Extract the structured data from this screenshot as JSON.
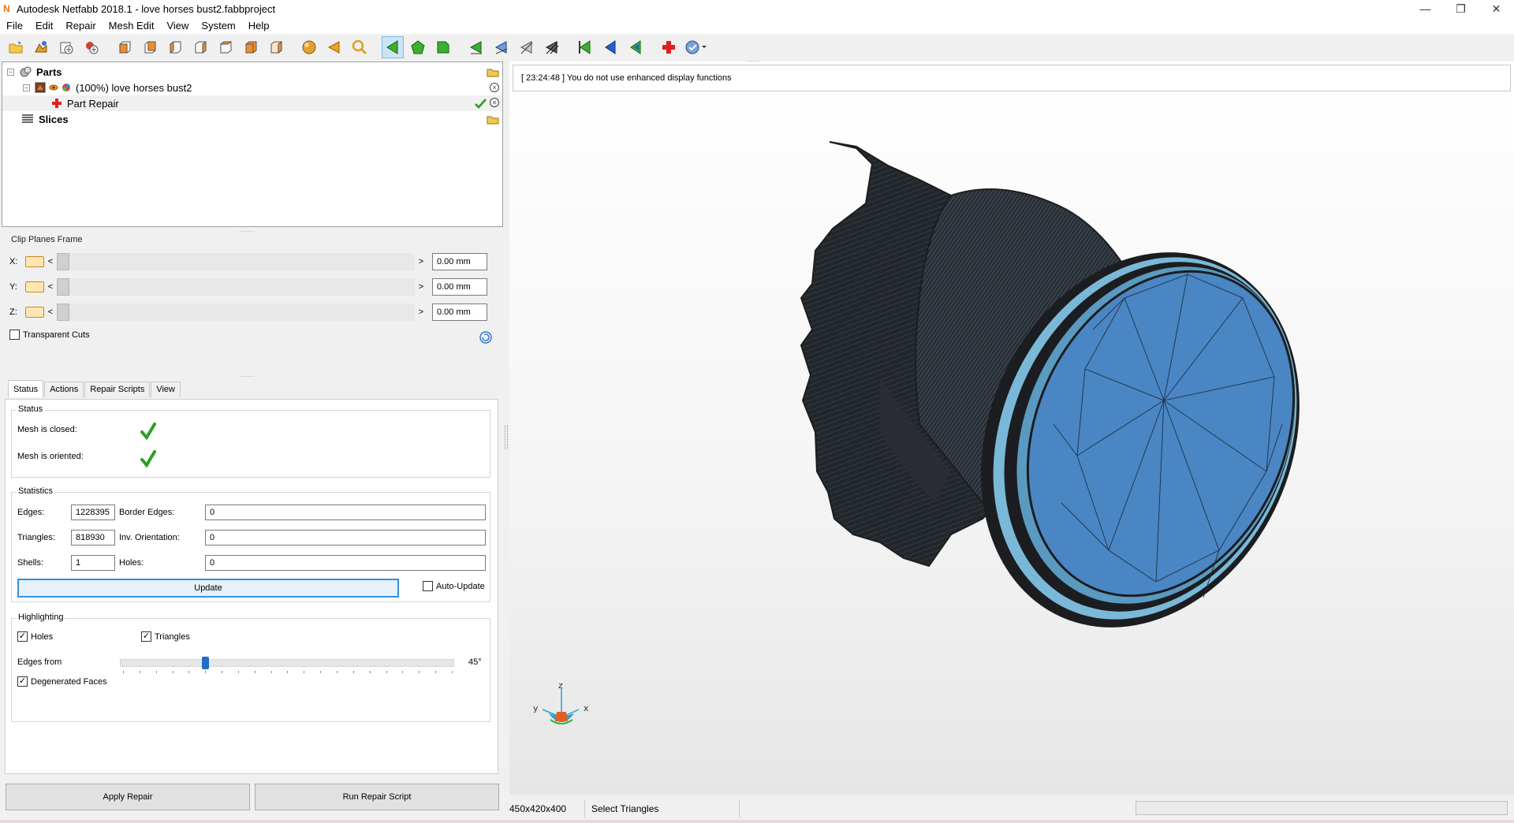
{
  "window": {
    "title": "Autodesk Netfabb 2018.1 - love horses bust2.fabbproject",
    "logo": "N",
    "minimize": "—",
    "maximize": "❐",
    "close": "✕"
  },
  "menu": [
    "File",
    "Edit",
    "Repair",
    "Mesh Edit",
    "View",
    "System",
    "Help"
  ],
  "toolbar_icons": [
    "open-folder-icon",
    "add-part-icon",
    "add-project-icon",
    "add-file-icon",
    "view-front-icon",
    "view-back-icon",
    "view-left-icon",
    "view-right-icon",
    "view-top-icon",
    "view-bottom-icon",
    "view-iso-icon",
    "sphere-icon",
    "triangle-arrow-icon",
    "zoom-icon",
    "select-triangles-icon",
    "select-surface-icon",
    "select-shell-icon",
    "select-edge-icon",
    "select-plane-icon",
    "lasso-icon",
    "lasso-dark-icon",
    "nav-green-icon",
    "nav-blue-icon",
    "nav-mixed-icon",
    "repair-cross-icon",
    "help-dropdown-icon"
  ],
  "tree": {
    "parts_label": "Parts",
    "part_name": "(100%) love horses bust2",
    "repair_label": "Part Repair",
    "slices_label": "Slices"
  },
  "clip_planes": {
    "title": "Clip Planes Frame",
    "rows": [
      {
        "axis": "X:",
        "value": "0.00 mm"
      },
      {
        "axis": "Y:",
        "value": "0.00 mm"
      },
      {
        "axis": "Z:",
        "value": "0.00 mm"
      }
    ],
    "left_arrow": "<",
    "right_arrow": ">",
    "transparent_cuts": "Transparent Cuts"
  },
  "tabs": [
    "Status",
    "Actions",
    "Repair Scripts",
    "View"
  ],
  "status_group": {
    "title": "Status",
    "mesh_closed": "Mesh is closed:",
    "mesh_oriented": "Mesh is oriented:"
  },
  "statistics": {
    "title": "Statistics",
    "edges_label": "Edges:",
    "edges_value": "1228395",
    "triangles_label": "Triangles:",
    "triangles_value": "818930",
    "shells_label": "Shells:",
    "shells_value": "1",
    "border_edges_label": "Border Edges:",
    "border_edges_value": "0",
    "inv_orientation_label": "Inv. Orientation:",
    "inv_orientation_value": "0",
    "holes_label": "Holes:",
    "holes_value": "0",
    "update_button": "Update",
    "auto_update": "Auto-Update"
  },
  "highlighting": {
    "title": "Highlighting",
    "holes": "Holes",
    "triangles": "Triangles",
    "edges_from": "Edges from",
    "edges_from_value": "45°",
    "edges_from_fraction": 0.25,
    "degenerated_faces": "Degenerated Faces"
  },
  "buttons": {
    "apply_repair": "Apply Repair",
    "run_repair_script": "Run Repair Script"
  },
  "log_message": "[ 23:24:48 ] You do not use enhanced display functions",
  "axes": {
    "x": "x",
    "y": "y",
    "z": "z"
  },
  "status_bar": {
    "dimensions": "450x420x400",
    "mode": "Select Triangles"
  }
}
